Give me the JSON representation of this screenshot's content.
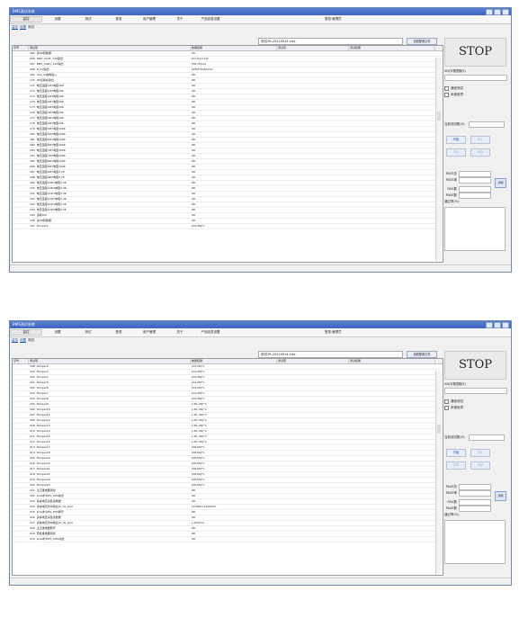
{
  "windows": [
    {
      "title": "BMS测试系统",
      "menu": [
        "监控",
        "设置",
        "测试",
        "登录",
        "用户管理",
        "关于",
        "产品信息设置"
      ],
      "login_label": "登录:管理员",
      "tabs": [
        "监控",
        "设置",
        "测试"
      ],
      "file_name": "测试36-20220914.xlsx",
      "load_button": "加载配置文件",
      "columns": [
        "序号",
        "测试项",
        "数据结果",
        "测试值",
        "测试结果"
      ],
      "rows": [
        {
          "no": "165",
          "item": "读SN码数据",
          "result": "OK"
        },
        {
          "no": "166",
          "item": "ROD_VoUT_12V输出",
          "result": "[11.8,12.2]V"
        },
        {
          "no": "167",
          "item": "BMS_CUR1_12V输出",
          "result": "[38,75]mA"
        },
        {
          "no": "168",
          "item": "D_5V输出",
          "result": "[4950,5050]mV"
        },
        {
          "no": "169",
          "item": "chg_on继电输入",
          "result": "OK"
        },
        {
          "no": "170",
          "item": "HS切换充输出",
          "result": "OK"
        },
        {
          "no": "171",
          "item": "电压温度1#1电阻10K",
          "result": "OK"
        },
        {
          "no": "172",
          "item": "电压温度1#2电阻10K",
          "result": "OK"
        },
        {
          "no": "173",
          "item": "电压温度1#3电阻10K",
          "result": "OK"
        },
        {
          "no": "174",
          "item": "电压温度2#1电阻10K",
          "result": "OK"
        },
        {
          "no": "175",
          "item": "电压温度2#2电阻10K",
          "result": "OK"
        },
        {
          "no": "176",
          "item": "电压温度3#1电阻10K",
          "result": "OK"
        },
        {
          "no": "177",
          "item": "电压温度4#1电阻10K",
          "result": "OK"
        },
        {
          "no": "178",
          "item": "电压温度4#2电阻10K",
          "result": "OK"
        },
        {
          "no": "179",
          "item": "电压温度5#1电阻100K",
          "result": "OK"
        },
        {
          "no": "180",
          "item": "电压温度5#2电阻100K",
          "result": "OK"
        },
        {
          "no": "181",
          "item": "电压温度6#1电阻100K",
          "result": "OK"
        },
        {
          "no": "182",
          "item": "电压温度6#2电阻100K",
          "result": "OK"
        },
        {
          "no": "183",
          "item": "电压温度7#1电阻100K",
          "result": "OK"
        },
        {
          "no": "184",
          "item": "电压温度7#2电阻100K",
          "result": "OK"
        },
        {
          "no": "185",
          "item": "电压温度8#1电阻100K",
          "result": "OK"
        },
        {
          "no": "186",
          "item": "电压温度8#2电阻100K",
          "result": "OK"
        },
        {
          "no": "187",
          "item": "电压温度9#1电阻3.7K",
          "result": "OK"
        },
        {
          "no": "188",
          "item": "电压温度9#2电阻3.7K",
          "result": "OK"
        },
        {
          "no": "189",
          "item": "电压温度10#1电阻3.3K",
          "result": "OK"
        },
        {
          "no": "190",
          "item": "电压温度10#2电阻3.3K",
          "result": "OK"
        },
        {
          "no": "191",
          "item": "电压温度11#1电阻3.3K",
          "result": "OK"
        },
        {
          "no": "192",
          "item": "电压温度11#2电阻3.3K",
          "result": "OK"
        },
        {
          "no": "193",
          "item": "电压温度12#1电阻3.3K",
          "result": "OK"
        },
        {
          "no": "194",
          "item": "电压温度12#2电阻3.3K",
          "result": "OK"
        },
        {
          "no": "195",
          "item": "读取IUS",
          "result": "OK"
        },
        {
          "no": "196",
          "item": "读SN码数据",
          "result": "OK"
        },
        {
          "no": "197",
          "item": "Temper1",
          "result": "[24,28]°C"
        }
      ],
      "stop_label": "STOP",
      "sn_label": "SN(字数限制3)",
      "check1": "通信测试",
      "check2": "未使用项",
      "count_label": "当前测试数(Y):",
      "start_btn": "开始",
      "stop_btn": "停止",
      "pause_btn": "暂停",
      "resume_btn": "继续",
      "pass_total_label": "PASS总",
      "pass_rate_label": "PASS率",
      "fail_label": "FAIL数",
      "pass_label": "PASS数",
      "yield_label": "通过率(%)",
      "clear_btn": "清除"
    },
    {
      "title": "BMS测试系统",
      "menu": [
        "监控",
        "设置",
        "测试",
        "登录",
        "用户管理",
        "关于",
        "产品信息设置"
      ],
      "login_label": "登录:管理员",
      "tabs": [
        "监控",
        "设置",
        "测试"
      ],
      "file_name": "测试36-20220914.xlsx",
      "load_button": "加载配置文件",
      "columns": [
        "序号",
        "测试项",
        "数据结果",
        "测试值",
        "测试结果"
      ],
      "rows": [
        {
          "no": "198",
          "item": "Temper2",
          "result": "[24,28]°C"
        },
        {
          "no": "199",
          "item": "Temper3",
          "result": "[24,28]°C"
        },
        {
          "no": "200",
          "item": "Temper4",
          "result": "[24,28]°C"
        },
        {
          "no": "201",
          "item": "Temper5",
          "result": "[24,28]°C"
        },
        {
          "no": "202",
          "item": "Temper6",
          "result": "[24,28]°C"
        },
        {
          "no": "203",
          "item": "Temper7",
          "result": "[24,28]°C"
        },
        {
          "no": "204",
          "item": "Temper8",
          "result": "[24,28]°C"
        },
        {
          "no": "205",
          "item": "Temper9",
          "result": "[-28,-26]°C"
        },
        {
          "no": "206",
          "item": "Temper10",
          "result": "[-28,-26]°C"
        },
        {
          "no": "207",
          "item": "Temper11",
          "result": "[-28,-26]°C"
        },
        {
          "no": "208",
          "item": "Temper12",
          "result": "[-28,-26]°C"
        },
        {
          "no": "209",
          "item": "Temper13",
          "result": "[-28,-26]°C"
        },
        {
          "no": "210",
          "item": "Temper14",
          "result": "[-28,-26]°C"
        },
        {
          "no": "211",
          "item": "Temper15",
          "result": "[-28,-26]°C"
        },
        {
          "no": "212",
          "item": "Temper16",
          "result": "[-28,-26]°C"
        },
        {
          "no": "213",
          "item": "Temper17",
          "result": "[58,60]°C"
        },
        {
          "no": "214",
          "item": "Temper18",
          "result": "[58,60]°C"
        },
        {
          "no": "215",
          "item": "Temper19",
          "result": "[58,60]°C"
        },
        {
          "no": "216",
          "item": "Temper20",
          "result": "[58,60]°C"
        },
        {
          "no": "217",
          "item": "Temper21",
          "result": "[58,60]°C"
        },
        {
          "no": "218",
          "item": "Temper22",
          "result": "[58,60]°C"
        },
        {
          "no": "219",
          "item": "Temper23",
          "result": "[58,60]°C"
        },
        {
          "no": "220",
          "item": "Temper24",
          "result": "[58,60]°C"
        },
        {
          "no": "221",
          "item": "主正继电器闭合",
          "result": "OK"
        },
        {
          "no": "222",
          "item": "bms命令HS_POS动合",
          "result": "OK"
        },
        {
          "no": "223",
          "item": "多操电压采集读数据",
          "result": "OK"
        },
        {
          "no": "224",
          "item": "多操电压仿中输出(U_hs_pos)",
          "result": "[11900,12100]mV"
        },
        {
          "no": "225",
          "item": "bms命令HS_POS断开",
          "result": "OK"
        },
        {
          "no": "226",
          "item": "多操电压采集读数据",
          "result": "OK"
        },
        {
          "no": "227",
          "item": "多操电压仿中输出(U_hs_pos)",
          "result": "[-200]mV"
        },
        {
          "no": "228",
          "item": "主正继电器断开",
          "result": "OK"
        },
        {
          "no": "229",
          "item": "预检继电器闭合",
          "result": "OK"
        },
        {
          "no": "230",
          "item": "bms命令HS_CHG动合",
          "result": "OK"
        }
      ],
      "stop_label": "STOP",
      "sn_label": "SN(字数限制3)",
      "check1": "通信测试",
      "check2": "未使用项",
      "count_label": "当前测试数(Y):",
      "start_btn": "开始",
      "stop_btn": "停止",
      "pause_btn": "暂停",
      "resume_btn": "继续",
      "pass_total_label": "PASS总",
      "pass_rate_label": "PASS率",
      "fail_label": "FAIL数",
      "pass_label": "PASS数",
      "yield_label": "通过率(%)",
      "clear_btn": "清除"
    }
  ]
}
